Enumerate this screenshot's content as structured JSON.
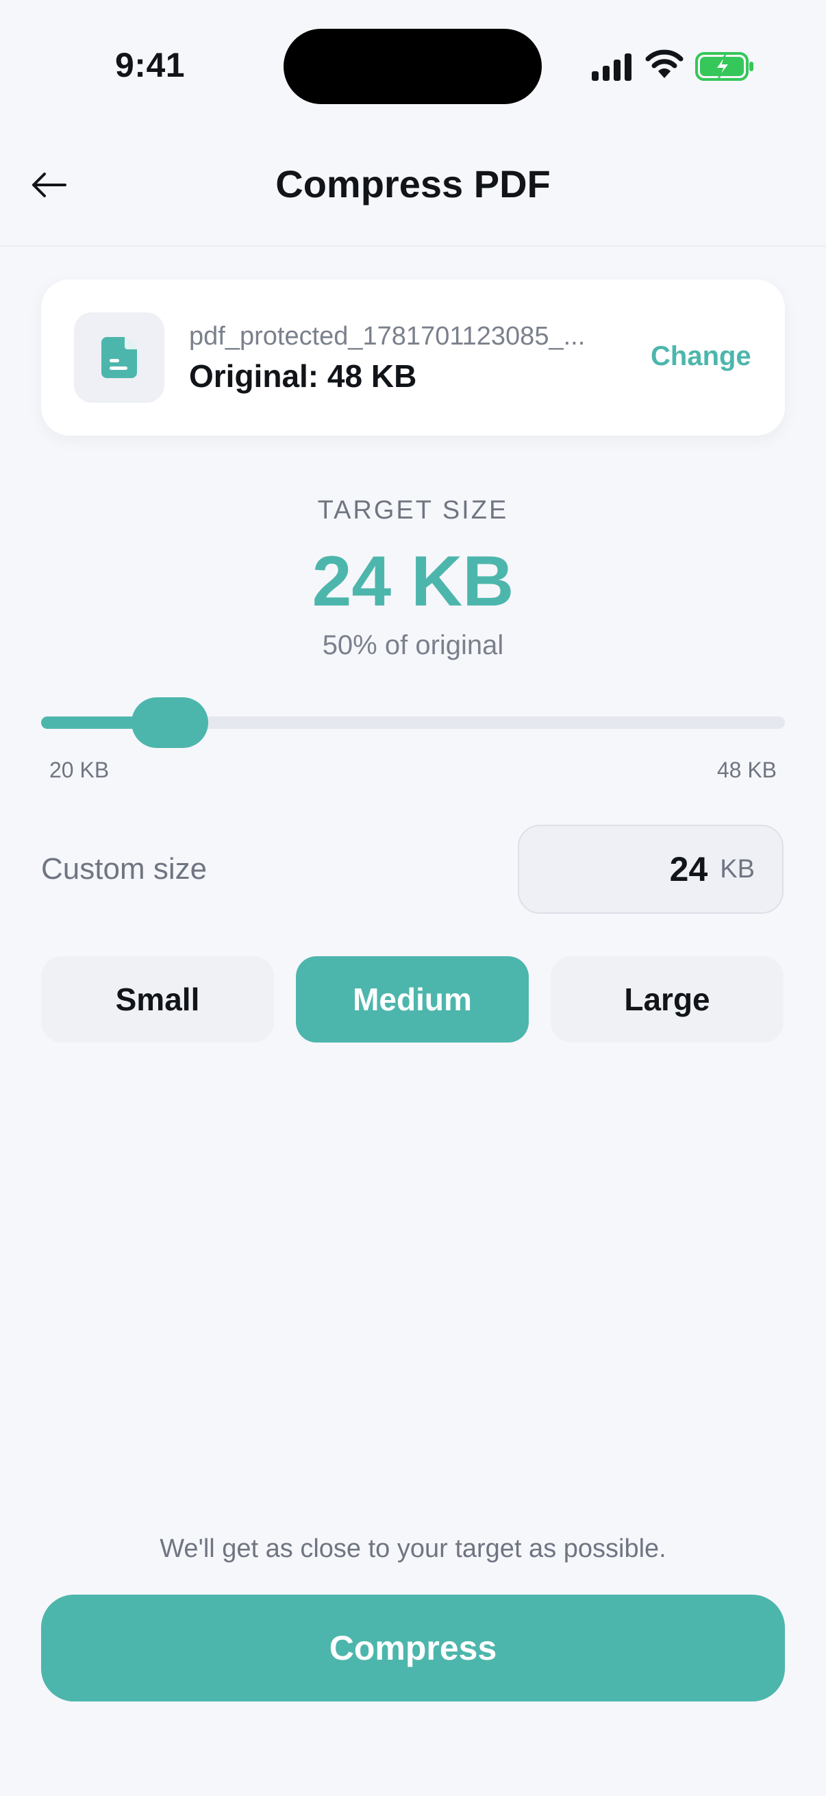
{
  "status_bar": {
    "time": "9:41"
  },
  "header": {
    "title": "Compress PDF",
    "back_icon": "arrow-left-icon"
  },
  "file": {
    "icon": "document-icon",
    "name": "pdf_protected_1781701123085_...",
    "original": "Original: 48 KB",
    "change_label": "Change"
  },
  "target": {
    "label": "TARGET SIZE",
    "value": "24 KB",
    "percent_text": "50% of original"
  },
  "slider": {
    "min_label": "20 KB",
    "max_label": "48 KB",
    "value_kb": 24,
    "min_kb": 20,
    "max_kb": 48
  },
  "custom": {
    "label": "Custom size",
    "value": "24",
    "unit": "KB"
  },
  "presets": [
    {
      "label": "Small",
      "active": false
    },
    {
      "label": "Medium",
      "active": true
    },
    {
      "label": "Large",
      "active": false
    }
  ],
  "footer": {
    "hint": "We'll get as close to your target as possible.",
    "button_label": "Compress"
  },
  "colors": {
    "accent": "#4db6ac",
    "background": "#f6f7fb",
    "card": "#ffffff",
    "muted_text": "#6f7581"
  }
}
